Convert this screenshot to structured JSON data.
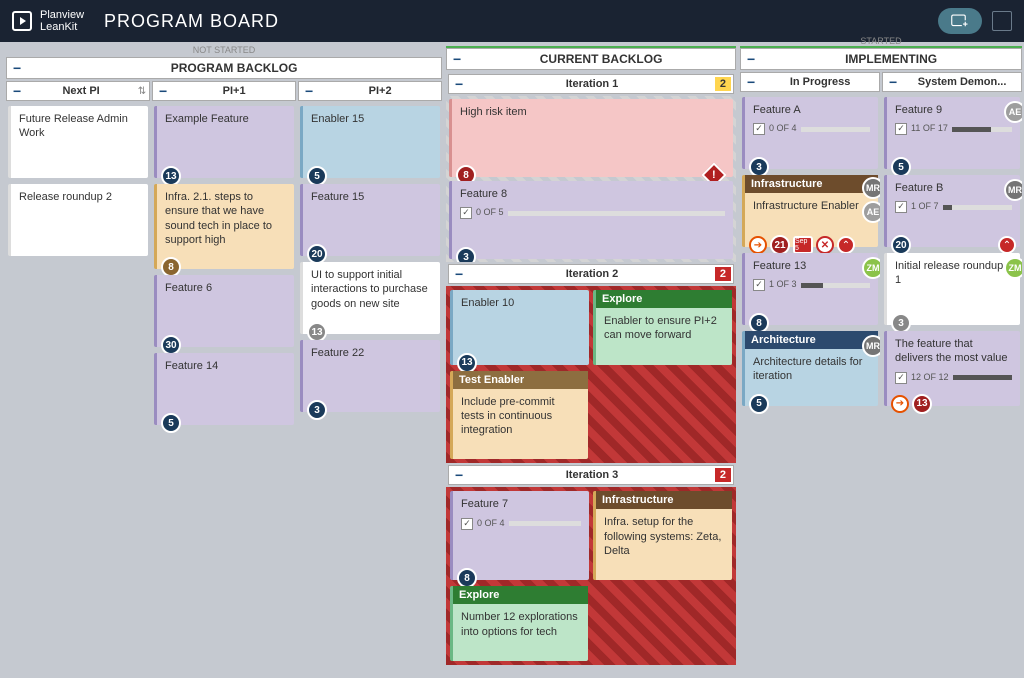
{
  "header": {
    "brand1": "Planview",
    "brand2": "LeanKit",
    "title": "PROGRAM BOARD"
  },
  "lanes": {
    "backlog": {
      "above": "NOT STARTED",
      "title": "PROGRAM BACKLOG",
      "cols": {
        "nextpi": "Next PI",
        "pi1": "PI+1",
        "pi2": "PI+2"
      }
    },
    "current": {
      "title": "CURRENT BACKLOG",
      "iter1": {
        "title": "Iteration 1",
        "badge": "2"
      },
      "iter2": {
        "title": "Iteration 2",
        "badge": "2"
      },
      "iter3": {
        "title": "Iteration 3",
        "badge": "2"
      }
    },
    "started": {
      "above": "STARTED",
      "title": "IMPLEMENTING",
      "cols": {
        "inprog": "In Progress",
        "demo": "System Demon..."
      }
    }
  },
  "cards": {
    "future_release": "Future Release Admin Work",
    "release_roundup": "Release roundup 2",
    "example_feature": "Example Feature",
    "infra21": "Infra. 2.1. steps to ensure that we have sound tech in place to support high",
    "feature6": "Feature 6",
    "feature14": "Feature 14",
    "enabler15": "Enabler 15",
    "feature15": "Feature 15",
    "ui_support": "UI to support initial interactions to purchase goods on new site",
    "feature22": "Feature 22",
    "high_risk": "High risk item",
    "feature8": "Feature 8",
    "enabler10": "Enabler 10",
    "explore_hdr": "Explore",
    "explore_body": "Enabler to ensure PI+2 can move forward",
    "test_enabler_hdr": "Test Enabler",
    "test_enabler_body": "Include pre-commit tests in continuous integration",
    "feature7": "Feature 7",
    "infra_hdr": "Infrastructure",
    "infra_body": "Infra. setup for the following systems: Zeta, Delta",
    "explore2_body": "Number 12 explorations into options for tech",
    "featureA": "Feature A",
    "infra_enabler_hdr": "Infrastructure",
    "infra_enabler_body": "Infrastructure Enabler",
    "feature13": "Feature 13",
    "arch_hdr": "Architecture",
    "arch_body": "Architecture details for iteration",
    "feature9": "Feature 9",
    "featureB": "Feature B",
    "initial_release": "Initial release roundup 1",
    "deliver_value": "The feature that delivers the most value"
  },
  "counts": {
    "c13": "13",
    "c8": "8",
    "c30": "30",
    "c5": "5",
    "c20": "20",
    "c3": "3",
    "c21": "21",
    "c11of17": "11 OF 17",
    "c0of5": "0 OF 5",
    "c0of4": "0 OF 4",
    "c1of7": "1 OF 7",
    "c1of3": "1 OF 3",
    "c12of12": "12 OF 12"
  },
  "avatars": {
    "ae": "AE",
    "mr": "MR",
    "zm": "ZM"
  },
  "date_badge": "Sep 5"
}
